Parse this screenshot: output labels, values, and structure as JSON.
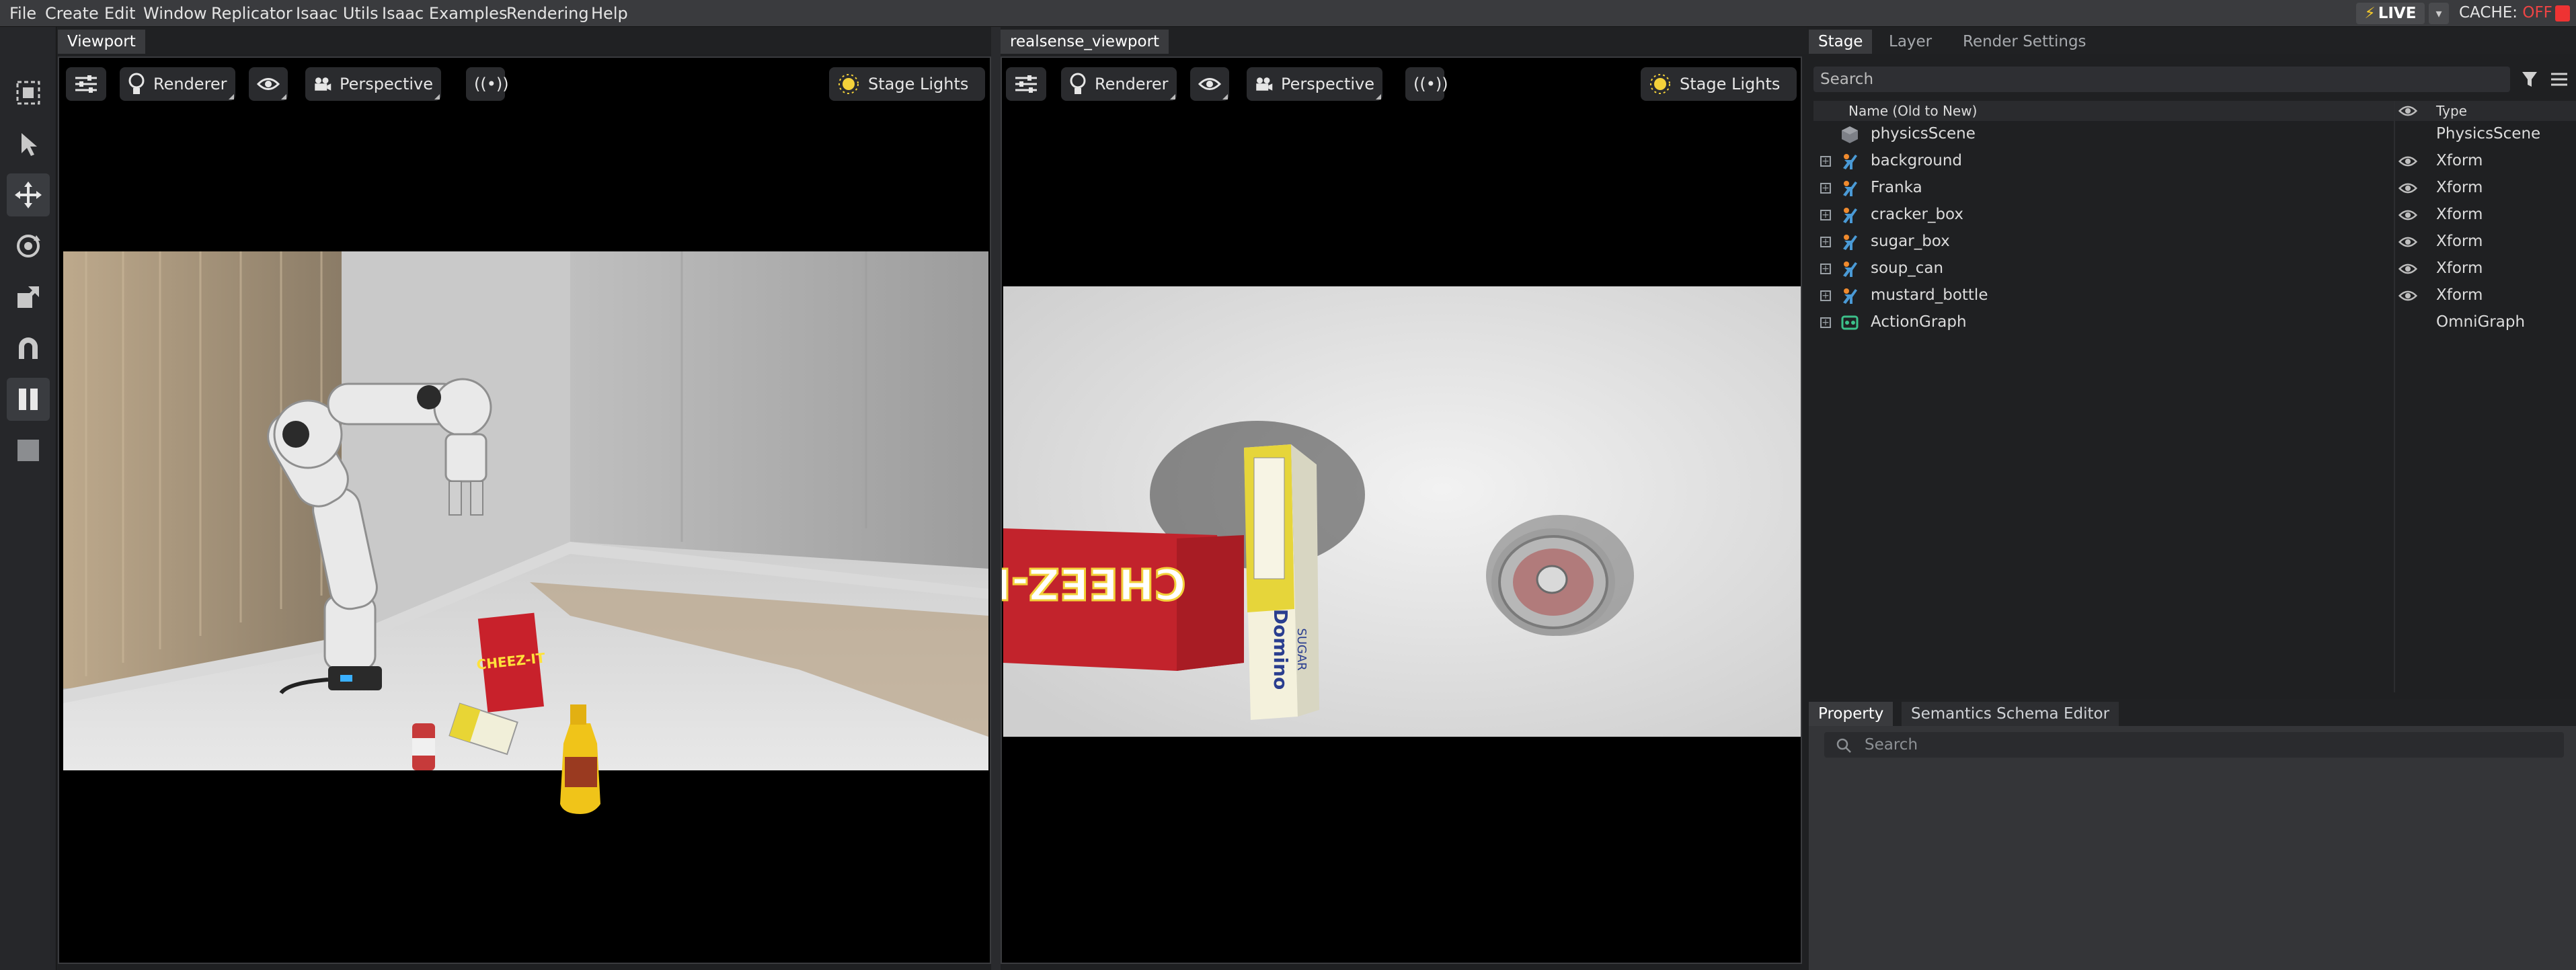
{
  "menu": [
    "File",
    "Create",
    "Edit",
    "Window",
    "Replicator",
    "Isaac Utils",
    "Isaac Examples",
    "Rendering",
    "Help"
  ],
  "status": {
    "live_label": "LIVE",
    "cache_label": "CACHE:",
    "cache_state": "OFF"
  },
  "viewport1": {
    "tab": "Viewport",
    "renderer": "Renderer",
    "camera": "Perspective",
    "lights": "Stage Lights"
  },
  "viewport2": {
    "tab": "realsense_viewport",
    "renderer": "Renderer",
    "camera": "Perspective",
    "lights": "Stage Lights"
  },
  "stage": {
    "tabs": [
      "Stage",
      "Layer",
      "Render Settings"
    ],
    "search_placeholder": "Search",
    "col_name": "Name (Old to New)",
    "col_type": "Type",
    "rows": [
      {
        "name": "physicsScene",
        "type": "PhysicsScene",
        "icon": "physics-scene-icon"
      },
      {
        "name": "background",
        "type": "Xform",
        "icon": "xform-icon"
      },
      {
        "name": "Franka",
        "type": "Xform",
        "icon": "xform-icon"
      },
      {
        "name": "cracker_box",
        "type": "Xform",
        "icon": "xform-icon"
      },
      {
        "name": "sugar_box",
        "type": "Xform",
        "icon": "xform-icon"
      },
      {
        "name": "soup_can",
        "type": "Xform",
        "icon": "xform-icon"
      },
      {
        "name": "mustard_bottle",
        "type": "Xform",
        "icon": "xform-icon"
      },
      {
        "name": "ActionGraph",
        "type": "OmniGraph",
        "icon": "omnigraph-icon"
      }
    ]
  },
  "property": {
    "tabs": [
      "Property",
      "Semantics Schema Editor"
    ],
    "search_placeholder": "Search"
  },
  "scene_labels": {
    "cracker_brand": "CHEEZ-IT",
    "sugar_brand": "Domino",
    "sugar_word": "SUGAR"
  }
}
